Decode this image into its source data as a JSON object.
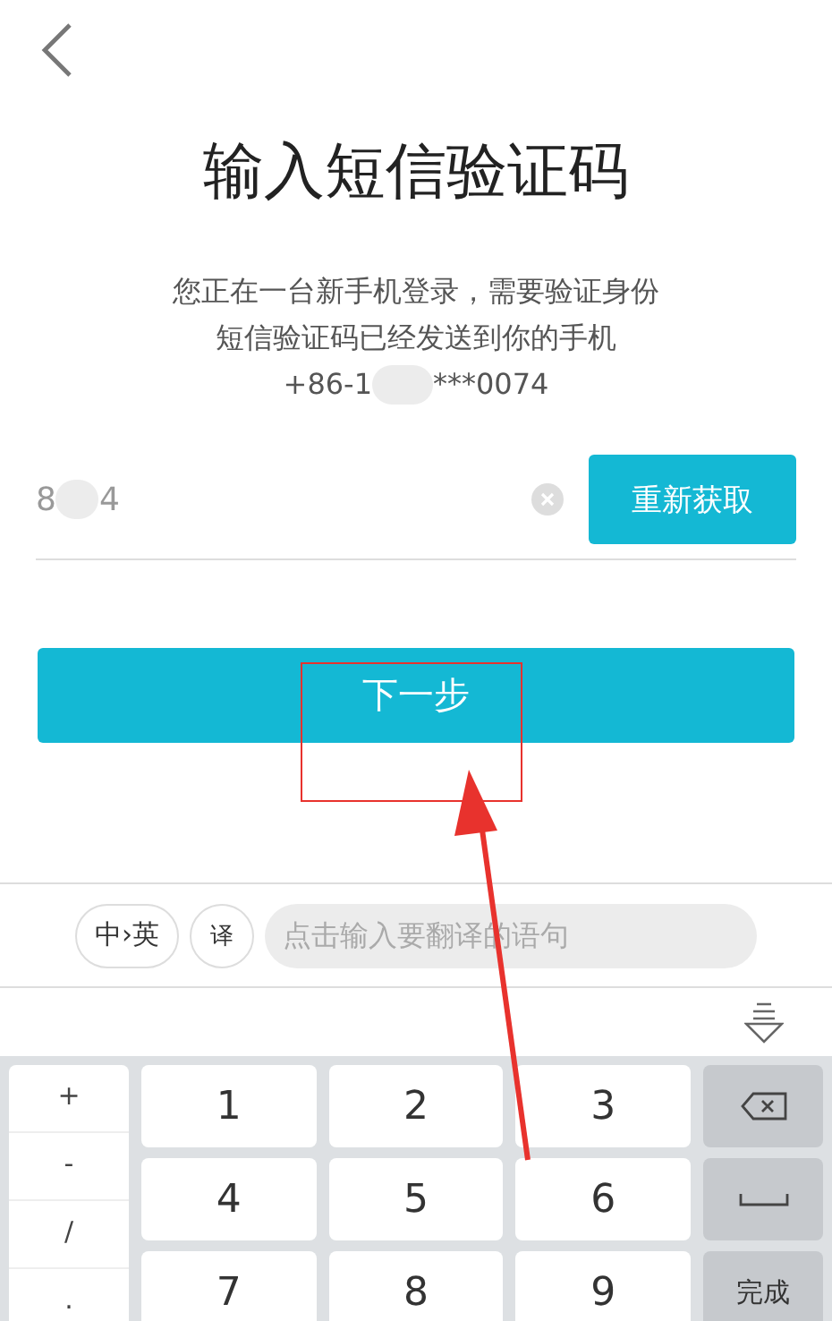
{
  "title": "输入短信验证码",
  "notice": {
    "lines": [
      "您正在一台新手机登录，需要验证身份",
      "短信验证码已经发送到你的手机"
    ],
    "phone_prefix": "+86-1",
    "phone_suffix": "***0074"
  },
  "code_field": {
    "value_start": "8",
    "value_end": "4",
    "resend": "重新获取"
  },
  "next_button": "下一步",
  "keyboard": {
    "lang_toggle": "中›英",
    "translate": "译",
    "translate_placeholder": "点击输入要翻译的语句",
    "symbols": [
      "+",
      "-",
      "/",
      "."
    ],
    "keys": [
      "1",
      "2",
      "3",
      "4",
      "5",
      "6",
      "7",
      "8",
      "9"
    ],
    "done": "完成"
  }
}
